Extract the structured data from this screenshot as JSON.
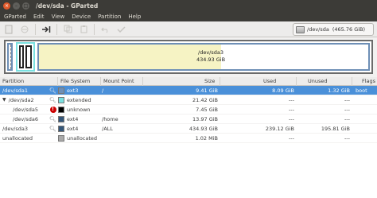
{
  "window": {
    "title": "/dev/sda - GParted",
    "controls": [
      "×",
      "–",
      "□"
    ]
  },
  "menu": [
    "GParted",
    "Edit",
    "View",
    "Device",
    "Partition",
    "Help"
  ],
  "device_selector": {
    "device": "/dev/sda",
    "size": "(465.76 GiB)"
  },
  "map": {
    "sda3_label": "/dev/sda3",
    "sda3_size": "434.93 GiB"
  },
  "columns": [
    "Partition",
    "File System",
    "Mount Point",
    "Size",
    "Used",
    "Unused",
    "Flags"
  ],
  "rows": [
    {
      "partition": "/dev/sda1",
      "fs": "ext3",
      "mount": "/",
      "size": "9.41 GiB",
      "used": "8.09 GiB",
      "unused": "1.32 GiB",
      "flags": "boot",
      "swatch": "#6e8fb6",
      "status": "key-icon"
    },
    {
      "partition": "/dev/sda2",
      "fs": "extended",
      "mount": "",
      "size": "21.42 GiB",
      "used": "---",
      "unused": "---",
      "flags": "",
      "swatch": "#7ae0e0",
      "status": "key-icon"
    },
    {
      "partition": "/dev/sda5",
      "fs": "unknown",
      "mount": "",
      "size": "7.45 GiB",
      "used": "---",
      "unused": "---",
      "flags": "",
      "swatch": "#000000",
      "status": "warning-icon"
    },
    {
      "partition": "/dev/sda6",
      "fs": "ext4",
      "mount": "/home",
      "size": "13.97 GiB",
      "used": "---",
      "unused": "---",
      "flags": "",
      "swatch": "#35577a",
      "status": "key-icon"
    },
    {
      "partition": "/dev/sda3",
      "fs": "ext4",
      "mount": "/ALL",
      "size": "434.93 GiB",
      "used": "239.12 GiB",
      "unused": "195.81 GiB",
      "flags": "",
      "swatch": "#35577a",
      "status": "key-icon"
    },
    {
      "partition": "unallocated",
      "fs": "unallocated",
      "mount": "",
      "size": "1.02 MiB",
      "used": "---",
      "unused": "---",
      "flags": "",
      "swatch": "#a9a9a9",
      "status": ""
    }
  ]
}
